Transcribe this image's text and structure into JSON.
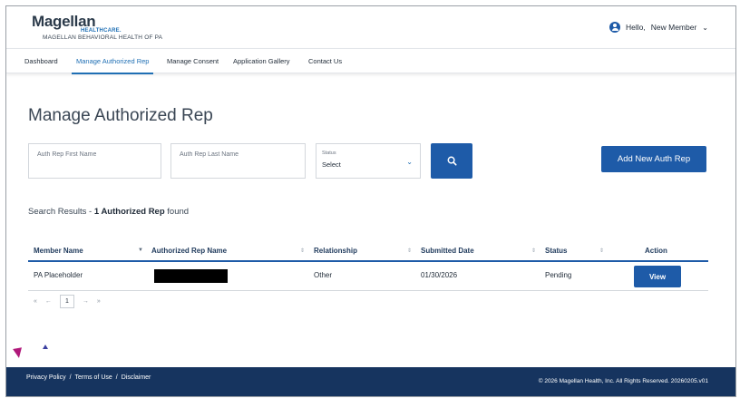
{
  "brand": {
    "logo_text": "Magellan",
    "logo_sub": "HEALTHCARE.",
    "org_name": "MAGELLAN BEHAVIORAL HEALTH OF PA"
  },
  "user": {
    "greeting": "Hello,",
    "name": "New Member"
  },
  "nav": {
    "items": [
      {
        "label": "Dashboard"
      },
      {
        "label": "Manage Authorized Rep"
      },
      {
        "label": "Manage Consent"
      },
      {
        "label": "Application Gallery"
      },
      {
        "label": "Contact Us"
      }
    ],
    "active": "Manage Authorized Rep"
  },
  "page": {
    "title": "Manage Authorized Rep"
  },
  "search": {
    "first_name_placeholder": "Auth Rep First Name",
    "first_name_value": "",
    "last_name_placeholder": "Auth Rep Last Name",
    "last_name_value": "",
    "status_label": "Status",
    "status_value": "Select",
    "add_button": "Add New Auth Rep"
  },
  "results": {
    "prefix": "Search Results - ",
    "count_text": "1 Authorized Rep",
    "suffix": " found"
  },
  "table": {
    "columns": [
      {
        "label": "Member Name"
      },
      {
        "label": "Authorized Rep Name"
      },
      {
        "label": "Relationship"
      },
      {
        "label": "Submitted Date"
      },
      {
        "label": "Status"
      },
      {
        "label": "Action"
      }
    ],
    "rows": [
      {
        "member_name": "PA Placeholder",
        "authorized_rep_name": "",
        "relationship": "Other",
        "submitted_date": "01/30/2026",
        "status": "Pending",
        "action": "View"
      }
    ]
  },
  "pagination": {
    "first": "«",
    "prev": "←",
    "current": "1",
    "next": "→",
    "last": "»"
  },
  "footer": {
    "links": [
      {
        "label": "Privacy Policy"
      },
      {
        "label": "Terms of Use"
      },
      {
        "label": "Disclaimer"
      }
    ],
    "separator": "/",
    "copyright": "© 2026 Magellan Health, Inc. All Rights Reserved. 20260205.v01"
  },
  "colors": {
    "primary": "#1e5ba8",
    "footer": "#16345f",
    "active_nav": "#1f6fb4"
  }
}
